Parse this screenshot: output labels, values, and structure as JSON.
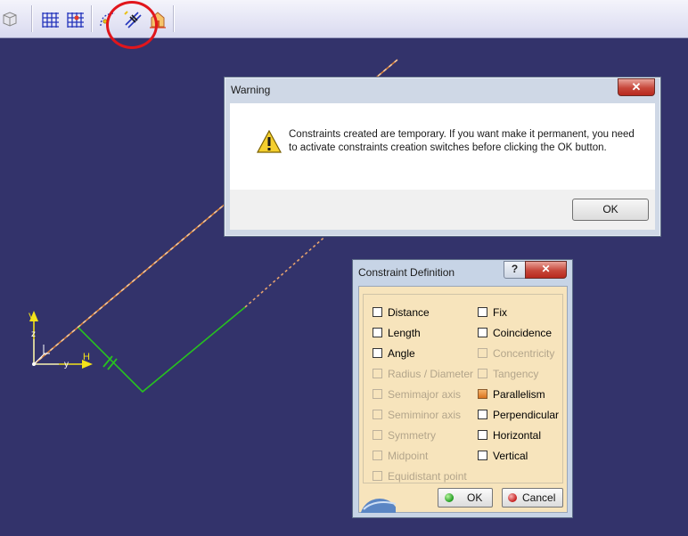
{
  "toolbar": {
    "icons": [
      "3d-view-icon",
      "grid-icon",
      "snap-to-grid-icon",
      "construction-element-icon",
      "geometrical-constraints-icon",
      "dimensional-constraints-icon"
    ]
  },
  "sketch": {
    "axis_v": "V",
    "axis_h": "H",
    "axis_z": "z",
    "axis_y": "y"
  },
  "warning_dialog": {
    "title": "Warning",
    "close_label": "✕",
    "message": "Constraints created are temporary. If you want make it permanent, you need to activate constraints creation switches before clicking the OK button.",
    "ok_label": "OK"
  },
  "constraint_dialog": {
    "title": "Constraint Definition",
    "help_label": "?",
    "close_label": "✕",
    "options_left": [
      {
        "label": "Distance",
        "enabled": true,
        "checked": false
      },
      {
        "label": "Length",
        "enabled": true,
        "checked": false
      },
      {
        "label": "Angle",
        "enabled": true,
        "checked": false
      },
      {
        "label": "Radius / Diameter",
        "enabled": false,
        "checked": false
      },
      {
        "label": "Semimajor axis",
        "enabled": false,
        "checked": false
      },
      {
        "label": "Semiminor axis",
        "enabled": false,
        "checked": false
      },
      {
        "label": "Symmetry",
        "enabled": false,
        "checked": false
      },
      {
        "label": "Midpoint",
        "enabled": false,
        "checked": false
      },
      {
        "label": "Equidistant point",
        "enabled": false,
        "checked": false
      }
    ],
    "options_right": [
      {
        "label": "Fix",
        "enabled": true,
        "checked": false
      },
      {
        "label": "Coincidence",
        "enabled": true,
        "checked": false
      },
      {
        "label": "Concentricity",
        "enabled": false,
        "checked": false
      },
      {
        "label": "Tangency",
        "enabled": false,
        "checked": false
      },
      {
        "label": "Parallelism",
        "enabled": true,
        "checked": true
      },
      {
        "label": "Perpendicular",
        "enabled": true,
        "checked": false
      },
      {
        "label": "Horizontal",
        "enabled": true,
        "checked": false
      },
      {
        "label": "Vertical",
        "enabled": true,
        "checked": false
      }
    ],
    "ok_label": "OK",
    "cancel_label": "Cancel"
  },
  "colors": {
    "background": "#33336b",
    "highlight_circle": "#e1161c",
    "line_orange": "#e8a05a",
    "constraint_green": "#27c21f",
    "axis_yellow": "#f3e21a"
  }
}
